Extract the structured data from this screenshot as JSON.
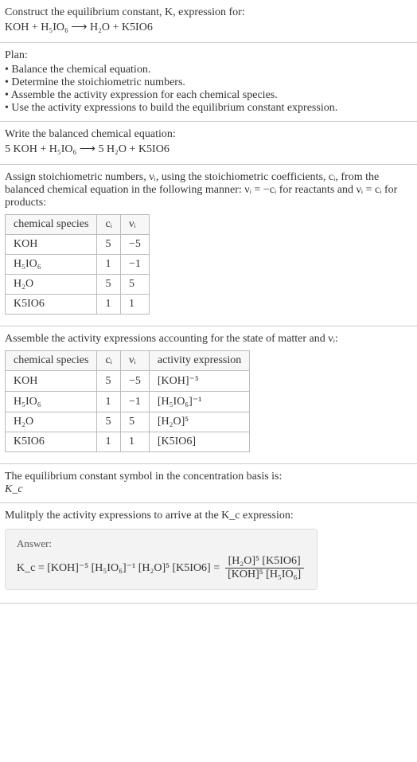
{
  "header": {
    "line1": "Construct the equilibrium constant, K, expression for:",
    "equation": "KOH + H₅IO₆  ⟶  H₂O + K5IO6"
  },
  "plan": {
    "title": "Plan:",
    "items": [
      "Balance the chemical equation.",
      "Determine the stoichiometric numbers.",
      "Assemble the activity expression for each chemical species.",
      "Use the activity expressions to build the equilibrium constant expression."
    ]
  },
  "balanced": {
    "title": "Write the balanced chemical equation:",
    "equation": "5 KOH + H₅IO₆  ⟶  5 H₂O + K5IO6"
  },
  "stoich": {
    "intro": "Assign stoichiometric numbers, νᵢ, using the stoichiometric coefficients, cᵢ, from the balanced chemical equation in the following manner: νᵢ = −cᵢ for reactants and νᵢ = cᵢ for products:",
    "headers": [
      "chemical species",
      "cᵢ",
      "νᵢ"
    ],
    "rows": [
      [
        "KOH",
        "5",
        "−5"
      ],
      [
        "H₅IO₆",
        "1",
        "−1"
      ],
      [
        "H₂O",
        "5",
        "5"
      ],
      [
        "K5IO6",
        "1",
        "1"
      ]
    ]
  },
  "activity": {
    "intro": "Assemble the activity expressions accounting for the state of matter and νᵢ:",
    "headers": [
      "chemical species",
      "cᵢ",
      "νᵢ",
      "activity expression"
    ],
    "rows": [
      [
        "KOH",
        "5",
        "−5",
        "[KOH]⁻⁵"
      ],
      [
        "H₅IO₆",
        "1",
        "−1",
        "[H₅IO₆]⁻¹"
      ],
      [
        "H₂O",
        "5",
        "5",
        "[H₂O]⁵"
      ],
      [
        "K5IO6",
        "1",
        "1",
        "[K5IO6]"
      ]
    ]
  },
  "symbol": {
    "line1": "The equilibrium constant symbol in the concentration basis is:",
    "line2": "K_c"
  },
  "multiply": {
    "title": "Mulitply the activity expressions to arrive at the K_c expression:"
  },
  "answer": {
    "label": "Answer:",
    "lhs": "K_c = [KOH]⁻⁵ [H₅IO₆]⁻¹ [H₂O]⁵ [K5IO6] =",
    "num": "[H₂O]⁵ [K5IO6]",
    "den": "[KOH]⁵ [H₅IO₆]"
  },
  "chart_data": {
    "type": "table",
    "tables": [
      {
        "title": "Stoichiometric numbers",
        "columns": [
          "chemical species",
          "c_i",
          "ν_i"
        ],
        "rows": [
          {
            "chemical species": "KOH",
            "c_i": 5,
            "ν_i": -5
          },
          {
            "chemical species": "H5IO6",
            "c_i": 1,
            "ν_i": -1
          },
          {
            "chemical species": "H2O",
            "c_i": 5,
            "ν_i": 5
          },
          {
            "chemical species": "K5IO6",
            "c_i": 1,
            "ν_i": 1
          }
        ]
      },
      {
        "title": "Activity expressions",
        "columns": [
          "chemical species",
          "c_i",
          "ν_i",
          "activity expression"
        ],
        "rows": [
          {
            "chemical species": "KOH",
            "c_i": 5,
            "ν_i": -5,
            "activity expression": "[KOH]^-5"
          },
          {
            "chemical species": "H5IO6",
            "c_i": 1,
            "ν_i": -1,
            "activity expression": "[H5IO6]^-1"
          },
          {
            "chemical species": "H2O",
            "c_i": 5,
            "ν_i": 5,
            "activity expression": "[H2O]^5"
          },
          {
            "chemical species": "K5IO6",
            "c_i": 1,
            "ν_i": 1,
            "activity expression": "[K5IO6]"
          }
        ]
      }
    ]
  }
}
